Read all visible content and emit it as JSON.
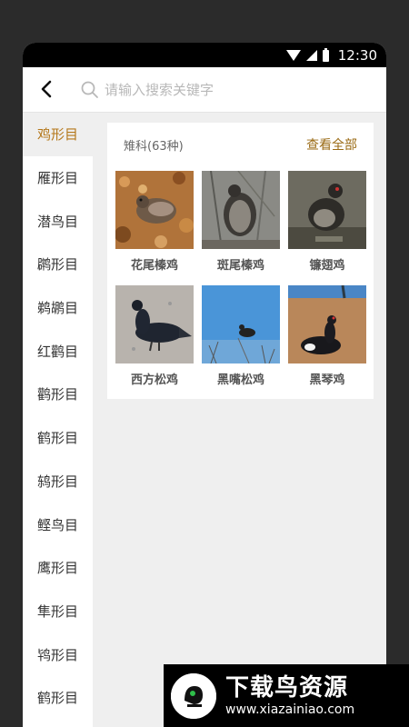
{
  "status_bar": {
    "time": "12:30",
    "icons": [
      "wifi-icon",
      "cell-signal-icon",
      "battery-icon"
    ]
  },
  "header": {
    "back_icon": "chevron-left-icon",
    "search_icon": "search-icon",
    "search_placeholder": "请输入搜索关键字",
    "search_value": ""
  },
  "sidebar": {
    "items": [
      {
        "label": "鸡形目",
        "active": true
      },
      {
        "label": "雁形目"
      },
      {
        "label": "潜鸟目"
      },
      {
        "label": "䴙形目"
      },
      {
        "label": "鹈鹕目"
      },
      {
        "label": "红鹳目"
      },
      {
        "label": "鹳形目"
      },
      {
        "label": "鹤形目"
      },
      {
        "label": "鸫形目"
      },
      {
        "label": "鲣鸟目"
      },
      {
        "label": "鹰形目"
      },
      {
        "label": "隼形目"
      },
      {
        "label": "鸨形目"
      },
      {
        "label": "鹤形目"
      }
    ],
    "active_color": "#b4771a"
  },
  "main": {
    "family_title": "雉科(63种)",
    "view_all_label": "查看全部",
    "birds": [
      {
        "name": "花尾榛鸡",
        "image": "hazel-grouse-photo"
      },
      {
        "name": "斑尾榛鸡",
        "image": "severtzov-grouse-photo"
      },
      {
        "name": "镰翅鸡",
        "image": "siberian-grouse-photo"
      },
      {
        "name": "西方松鸡",
        "image": "capercaillie-photo"
      },
      {
        "name": "黑嘴松鸡",
        "image": "black-billed-capercaillie-photo"
      },
      {
        "name": "黑琴鸡",
        "image": "black-grouse-photo"
      }
    ]
  },
  "watermark": {
    "title": "下载鸟资源",
    "url": "www.xiazainiao.com"
  }
}
